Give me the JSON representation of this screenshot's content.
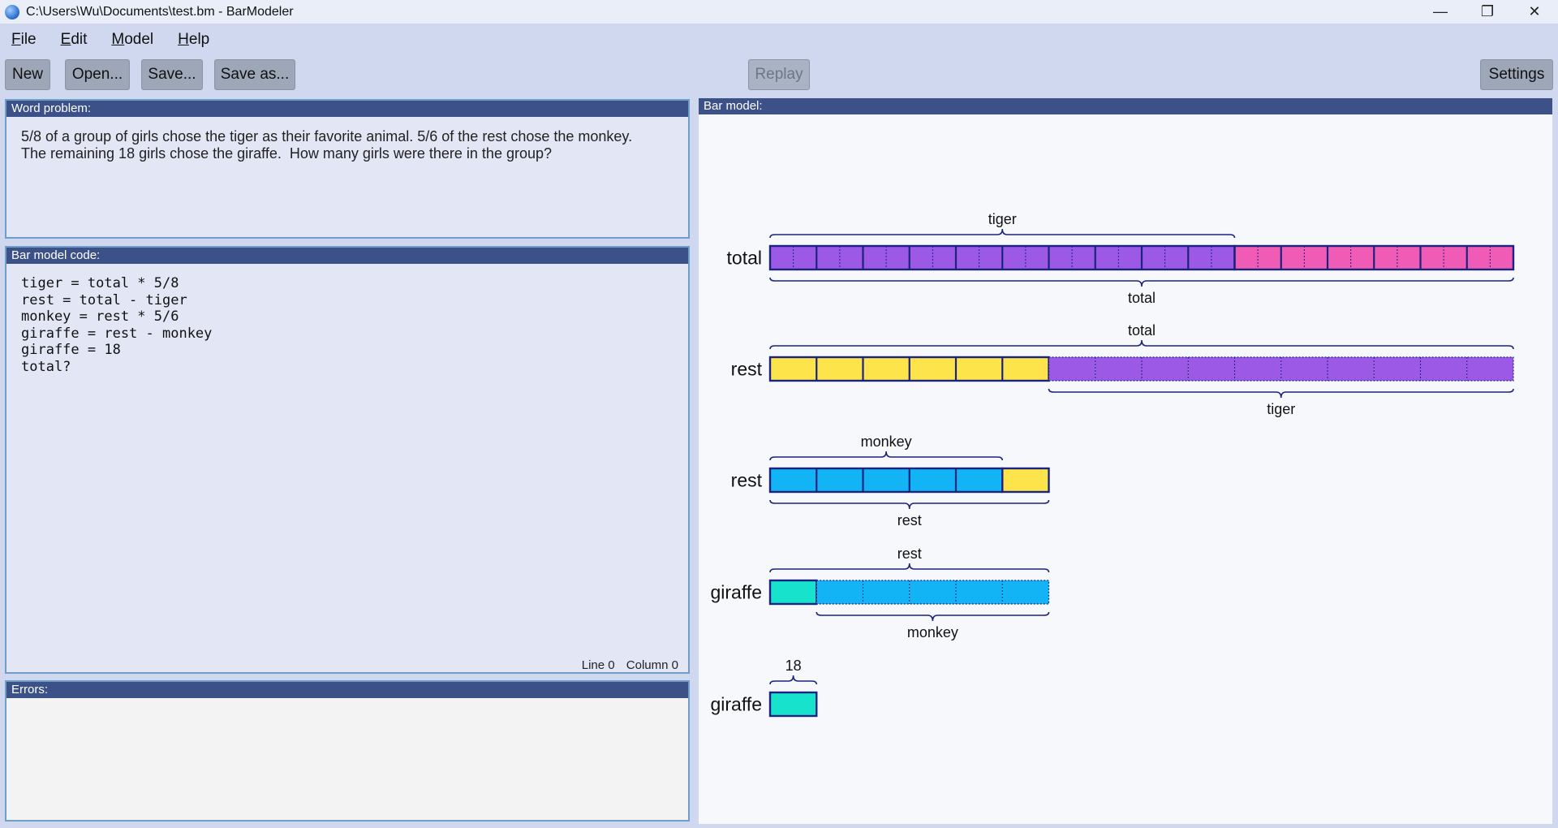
{
  "window": {
    "title": "C:\\Users\\Wu\\Documents\\test.bm - BarModeler",
    "controls": {
      "minimize": "—",
      "restore": "❐",
      "close": "✕"
    }
  },
  "menu": [
    {
      "accel": "F",
      "rest": "ile"
    },
    {
      "accel": "E",
      "rest": "dit"
    },
    {
      "accel": "M",
      "rest": "odel"
    },
    {
      "accel": "H",
      "rest": "elp"
    }
  ],
  "toolbar": {
    "new_label": "New",
    "open_label": "Open...",
    "save_label": "Save...",
    "save_as_label": "Save as...",
    "replay_label": "Replay",
    "settings_label": "Settings"
  },
  "word_problem": {
    "header": "Word problem:",
    "text": "5/8 of a group of girls chose the tiger as their favorite animal. 5/6 of the rest chose the monkey.\nThe remaining 18 girls chose the giraffe.  How many girls were there in the group?"
  },
  "code": {
    "header": "Bar model code:",
    "text": "tiger = total * 5/8\nrest = total - tiger\nmonkey = rest * 5/6\ngiraffe = rest - monkey\ngiraffe = 18\ntotal?",
    "status_line": "Line 0",
    "status_column": "Column 0"
  },
  "errors": {
    "header": "Errors:"
  },
  "bar_model": {
    "header": "Bar model:",
    "colors": {
      "purple": "#9b59e6",
      "pink": "#ef5bb5",
      "yellow": "#fde44a",
      "blue": "#12b4f5",
      "teal": "#17e3cd",
      "outline": "#1a237e"
    },
    "rows": [
      {
        "label": "total",
        "units": 16,
        "segments": [
          {
            "units": 10,
            "color": "purple",
            "subunits": 2
          },
          {
            "units": 6,
            "color": "pink",
            "subunits": 2
          }
        ],
        "top_brace": {
          "text": "tiger",
          "from": 0,
          "to": 10
        },
        "bottom_brace": {
          "text": "total",
          "from": 0,
          "to": 16
        }
      },
      {
        "label": "rest",
        "units": 16,
        "segments": [
          {
            "units": 6,
            "color": "yellow",
            "subunits": 1
          },
          {
            "units": 10,
            "color": "purple",
            "subunits": 1,
            "dotted": true
          }
        ],
        "top_brace": {
          "text": "total",
          "from": 0,
          "to": 16
        },
        "bottom_brace": {
          "text": "tiger",
          "from": 6,
          "to": 16
        }
      },
      {
        "label": "rest",
        "units": 6,
        "segments": [
          {
            "units": 5,
            "color": "blue",
            "subunits": 1
          },
          {
            "units": 1,
            "color": "yellow",
            "subunits": 1
          }
        ],
        "top_brace": {
          "text": "monkey",
          "from": 0,
          "to": 5
        },
        "bottom_brace": {
          "text": "rest",
          "from": 0,
          "to": 6
        }
      },
      {
        "label": "giraffe",
        "units": 6,
        "segments": [
          {
            "units": 1,
            "color": "teal",
            "subunits": 1
          },
          {
            "units": 5,
            "color": "blue",
            "subunits": 1,
            "dotted": true
          }
        ],
        "top_brace": {
          "text": "rest",
          "from": 0,
          "to": 6
        },
        "bottom_brace": {
          "text": "monkey",
          "from": 1,
          "to": 6
        }
      },
      {
        "label": "giraffe",
        "units": 1,
        "segments": [
          {
            "units": 1,
            "color": "teal",
            "subunits": 1
          }
        ],
        "top_brace": {
          "text": "18",
          "from": 0,
          "to": 1
        }
      }
    ]
  }
}
